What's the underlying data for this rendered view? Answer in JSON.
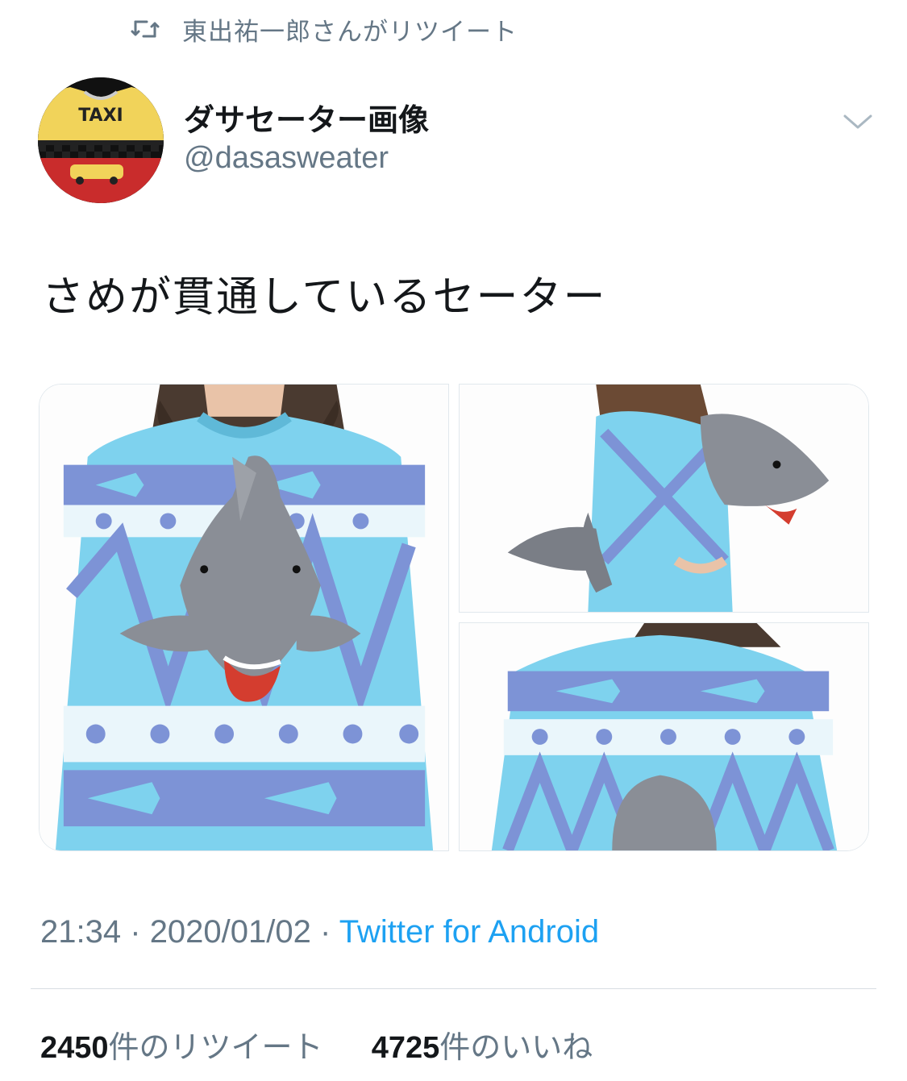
{
  "retweet_header": {
    "icon": "retweet-icon",
    "text": "東出祐一郎さんがリツイート"
  },
  "author": {
    "display_name": "ダサセーター画像",
    "handle": "@dasasweater",
    "avatar_logo_text": "TAXI"
  },
  "tweet": {
    "text": "さめが貫通しているセーター"
  },
  "meta": {
    "time": "21:34",
    "separator": "·",
    "date": "2020/01/02",
    "source": "Twitter for Android"
  },
  "stats": {
    "retweets_count": "2450",
    "retweets_label": "件のリツイート",
    "likes_count": "4725",
    "likes_label": "件のいいね"
  },
  "colors": {
    "link": "#1da1f2",
    "secondary": "#657786",
    "sweater_light": "#7ed2ee",
    "sweater_dark": "#7d93d6"
  }
}
